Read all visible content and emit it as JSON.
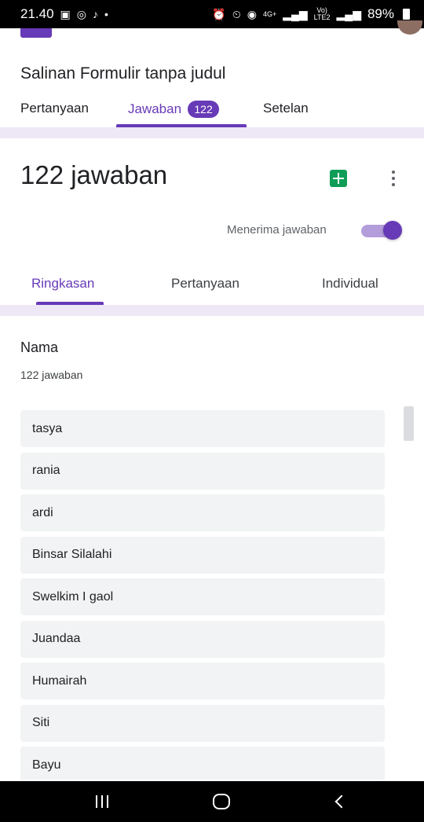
{
  "status_bar": {
    "time": "21.40",
    "network": "4G+",
    "volte_top": "Vo)",
    "volte_bottom": "LTE2",
    "battery": "89%"
  },
  "form": {
    "title": "Salinan Formulir tanpa judul"
  },
  "main_tabs": {
    "questions": "Pertanyaan",
    "responses": "Jawaban",
    "responses_badge": "122",
    "settings": "Setelan"
  },
  "responses": {
    "count_label": "122 jawaban",
    "accepting_label": "Menerima jawaban",
    "accepting": true
  },
  "sub_tabs": {
    "summary": "Ringkasan",
    "question": "Pertanyaan",
    "individual": "Individual"
  },
  "question": {
    "title": "Nama",
    "response_count": "122 jawaban",
    "answers": [
      "tasya",
      "rania",
      "ardi",
      "Binsar Silalahi",
      "Swelkim I gaol",
      "Juandaa",
      "Humairah",
      "Siti",
      "Bayu"
    ]
  },
  "colors": {
    "accent": "#673ab7",
    "accent_light": "#ede7f6",
    "sheets_green": "#0f9d58"
  },
  "icons": {
    "sheets": "google-sheets-icon",
    "more": "more-vert-icon",
    "recents": "recents-icon",
    "home": "home-icon",
    "back": "back-icon"
  }
}
